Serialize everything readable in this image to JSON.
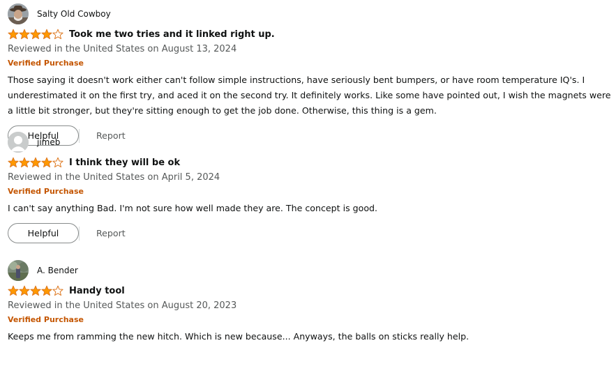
{
  "colors": {
    "star_fill": "#ff9900",
    "star_stroke": "#de7921",
    "verified": "#c45500",
    "muted": "#565959",
    "text": "#0f1111"
  },
  "reviews": [
    {
      "profile_name": "Salty Old Cowboy",
      "avatar": "cowboy-photo",
      "rating": 4,
      "title": "Took me two tries and it linked right up.",
      "date": "Reviewed in the United States on August 13, 2024",
      "badge": "Verified Purchase",
      "body": "Those saying it doesn't work either can't follow simple instructions, have seriously bent bumpers, or have room temperature IQ's. I underestimated it on the first try, and aced it on the second try. It definitely works. Like some have pointed out, I wish the magnets were a little bit stronger, but they're sitting enough to get the job done. Otherwise, this thing is a gem.",
      "helpful_label": "Helpful",
      "report_label": "Report"
    },
    {
      "profile_name": "jimeb",
      "avatar": "default-person",
      "rating": 4,
      "title": "I think they will be ok",
      "date": "Reviewed in the United States on April 5, 2024",
      "badge": "Verified Purchase",
      "body": "I can't say anything Bad. I'm not sure how well made they are. The concept is good.",
      "helpful_label": "Helpful",
      "report_label": "Report"
    },
    {
      "profile_name": "A. Bender",
      "avatar": "outdoor-photo",
      "rating": 4,
      "title": "Handy tool",
      "date": "Reviewed in the United States on August 20, 2023",
      "badge": "Verified Purchase",
      "body": "Keeps me from ramming the new hitch. Which is new because... Anyways, the balls on sticks really help.",
      "helpful_label": "",
      "report_label": ""
    }
  ]
}
